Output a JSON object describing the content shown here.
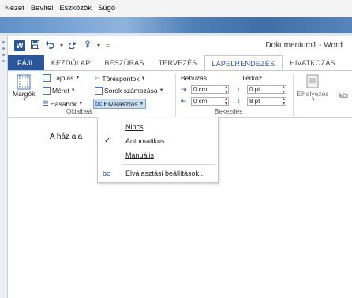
{
  "host_menu": [
    "Nézet",
    "Bevitel",
    "Eszközök",
    "Súgó"
  ],
  "qat": {
    "word_icon": "W",
    "save_icon": "save-icon",
    "undo_icon": "undo-icon",
    "redo_icon": "redo-icon",
    "customize_icon": "customize-qat-icon"
  },
  "window": {
    "doc_title": "Dokumentum1 - Word"
  },
  "tabs": [
    {
      "label": "FÁJL"
    },
    {
      "label": "KEZDŐLAP"
    },
    {
      "label": "BESZÚRÁS"
    },
    {
      "label": "TERVEZÉS"
    },
    {
      "label": "LAPELRENDEZÉS"
    },
    {
      "label": "HIVATKOZÁS"
    }
  ],
  "active_tab": "LAPELRENDEZÉS",
  "ribbon": {
    "margins": "Margók",
    "orientation": "Tájolás",
    "size": "Méret",
    "columns": "Hasábok",
    "breaks": "Töréspontok",
    "line_numbers": "Sorok számozása",
    "hyphenation": "Elválasztás",
    "group_page_setup": "Oldalbeá",
    "indent_label": "Behúzás",
    "spacing_label": "Térköz",
    "indent_left": "0 cm",
    "indent_right": "0 cm",
    "spacing_before": "0 pt",
    "spacing_after": "8 pt",
    "group_paragraph": "Bekezdés",
    "position": "Elhelyezés",
    "wrap_cut": "kör"
  },
  "dropdown": {
    "items": [
      "Nincs",
      "Automatikus",
      "Manuális"
    ],
    "options_label": "Elválasztási beállítások...",
    "selected": "Automatikus"
  },
  "document": {
    "visible_text": "A ház ala"
  },
  "colors": {
    "accent": "#2b579a",
    "pressed": "#c5dcf2"
  }
}
